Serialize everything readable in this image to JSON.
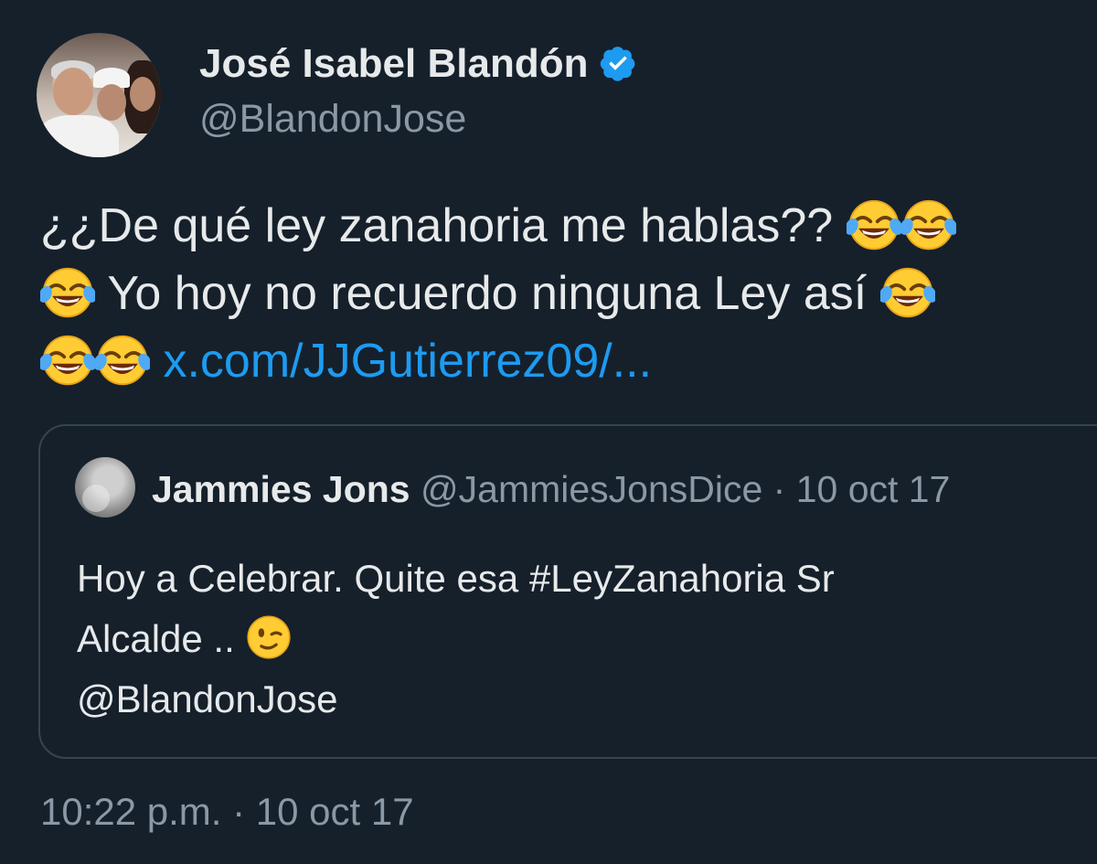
{
  "author": {
    "name": "José Isabel Blandón",
    "handle": "@BlandonJose",
    "verified_icon": "verified-badge-icon",
    "verified_color": "#1d9bf0"
  },
  "tweet": {
    "line1_text": "¿¿De qué ley zanahoria me hablas?? ",
    "line2_text": " Yo hoy no recuerdo ninguna Ley así ",
    "link_text": "x.com/JJGutierrez09/...",
    "emoji_name": "face-with-tears-of-joy"
  },
  "quoted_tweet": {
    "name": "Jammies Jons",
    "handle": "@JammiesJonsDice",
    "separator": " · ",
    "date": "10 oct 17",
    "line1": "Hoy a Celebrar. Quite esa #LeyZanahoria Sr",
    "line2": "Alcalde .. ",
    "line3": "@BlandonJose",
    "emoji_name": "winking-face"
  },
  "meta": {
    "timestamp": "10:22 p.m. · 10 oct 17"
  },
  "colors": {
    "background": "#15202b",
    "text": "#e7e9ea",
    "secondary": "#8b98a5",
    "link": "#1d9bf0",
    "border": "#38444d"
  }
}
